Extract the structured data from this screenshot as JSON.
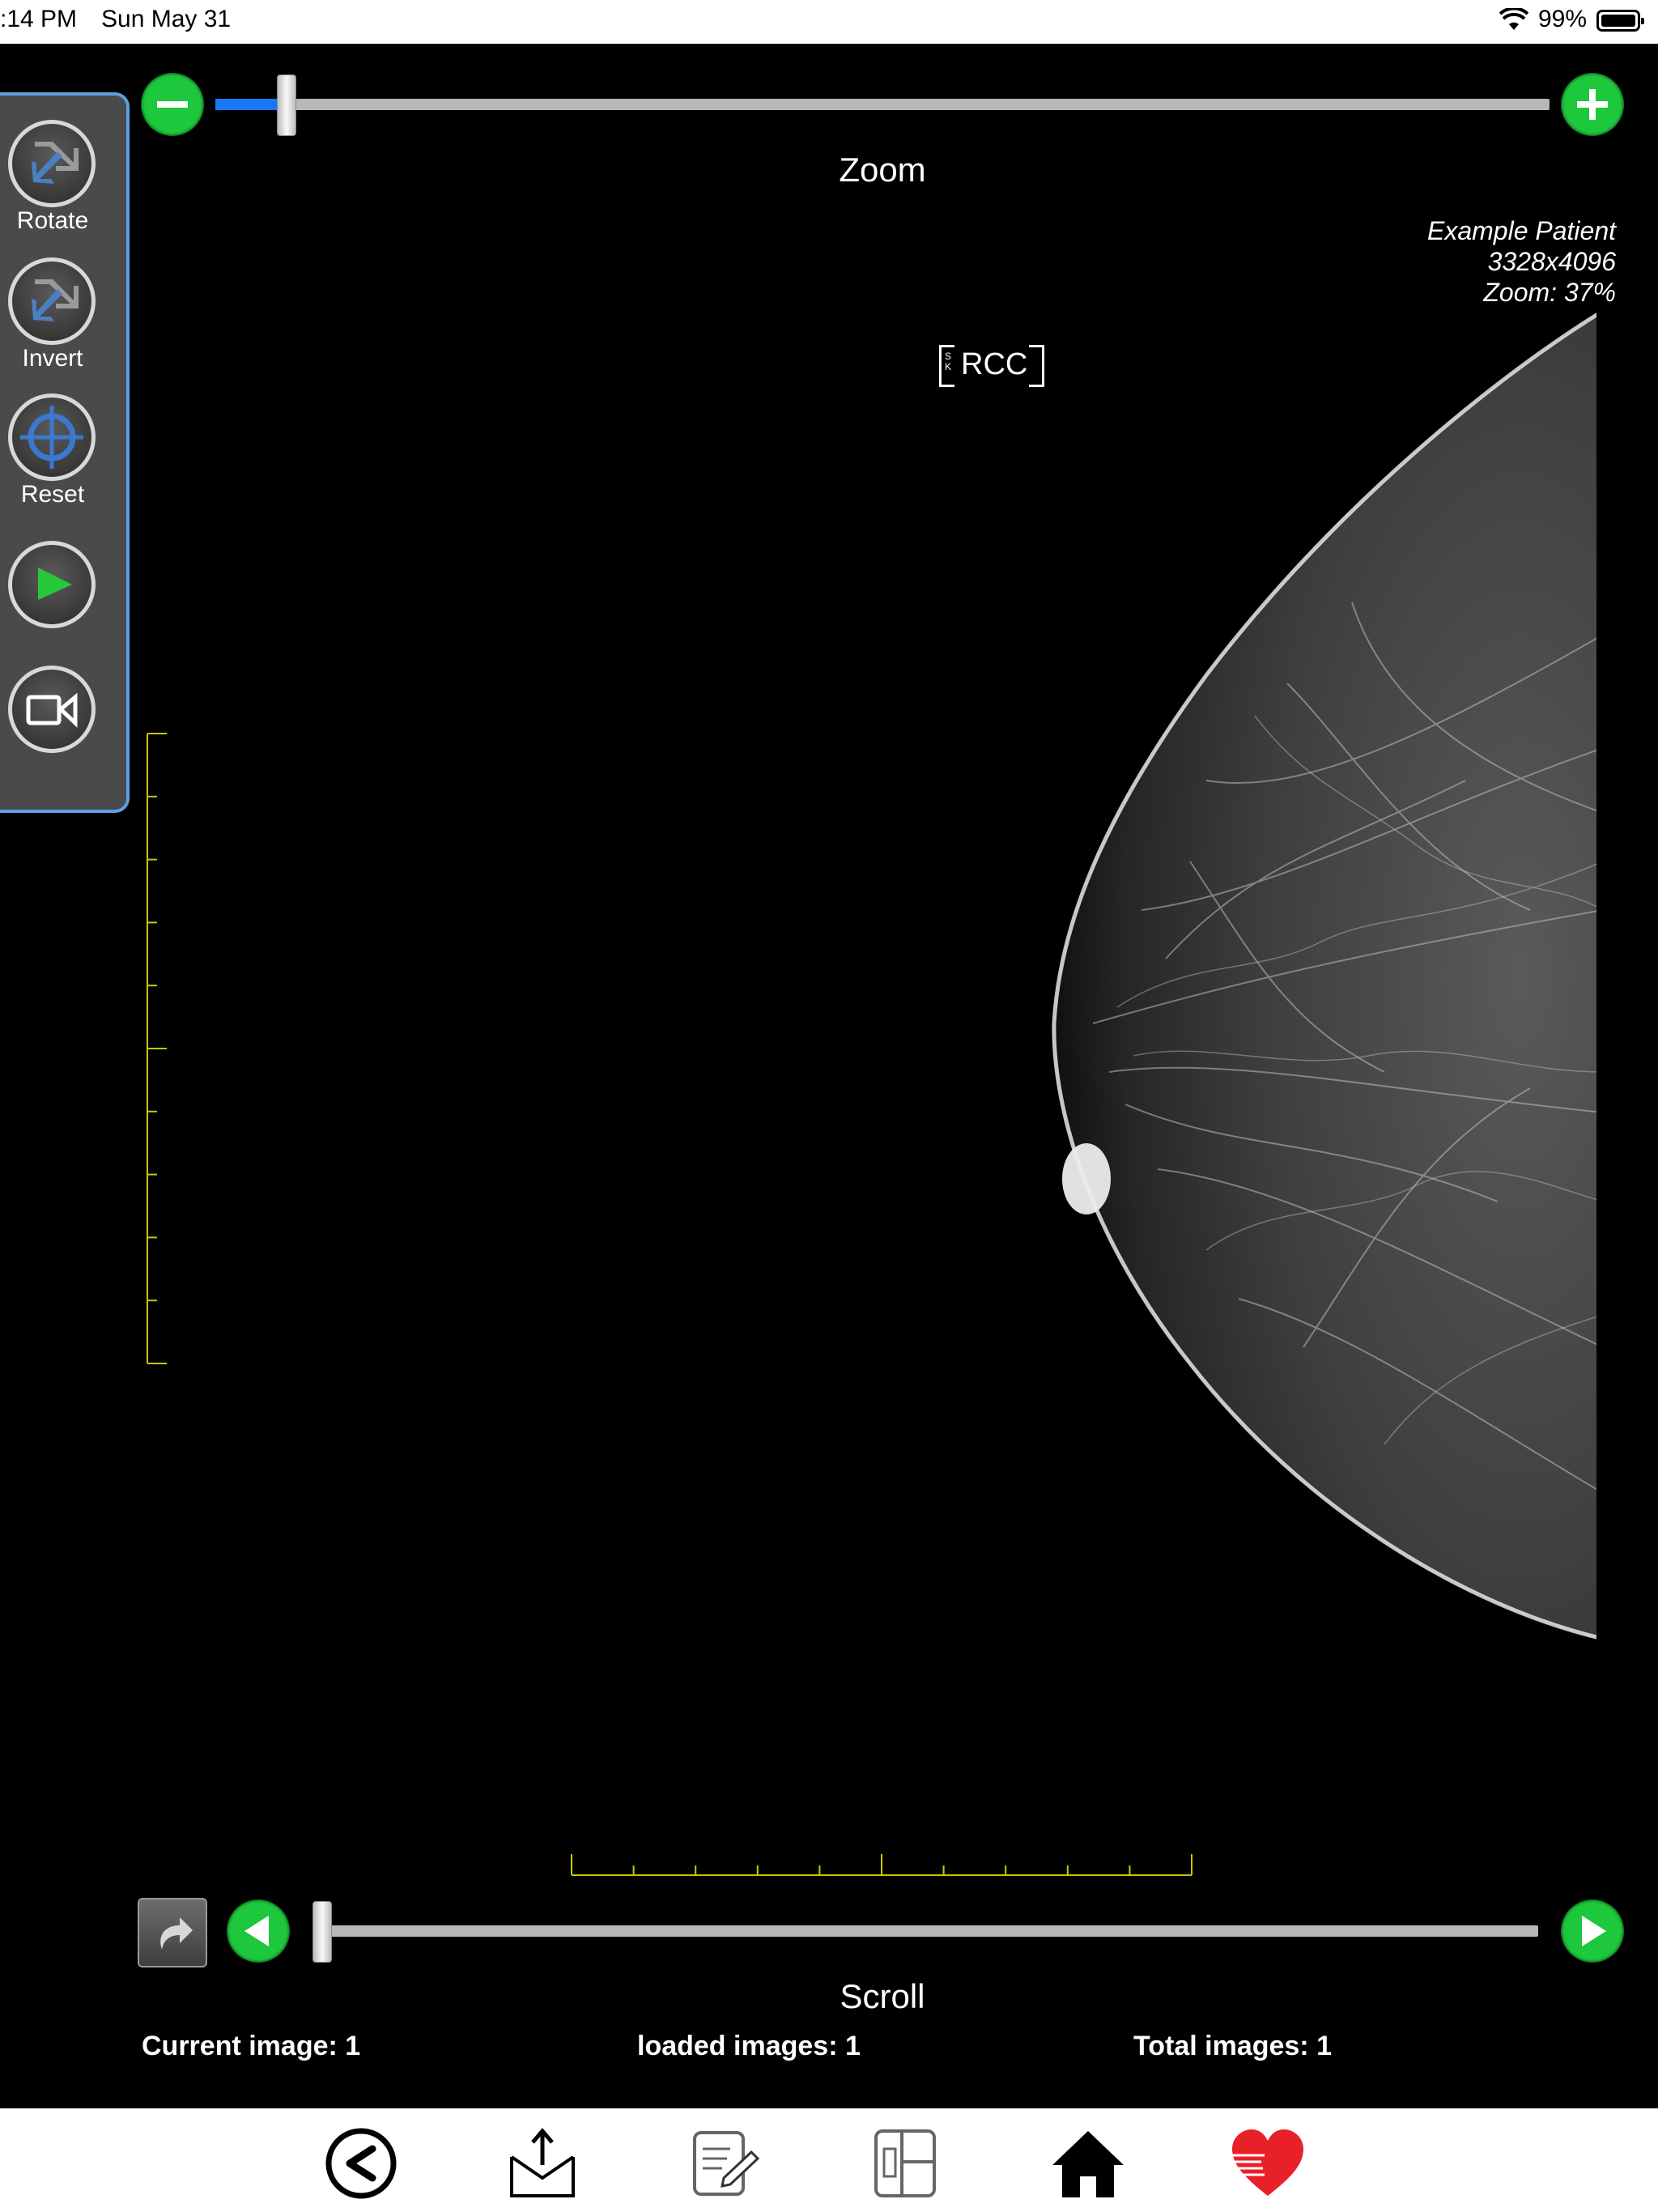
{
  "status_bar": {
    "time": ":14 PM",
    "date": "Sun May 31",
    "battery_percent": "99%",
    "battery_level": 0.99
  },
  "toolbar": {
    "tools": [
      {
        "label": "Rotate",
        "icon": "rotate-icon"
      },
      {
        "label": "Invert",
        "icon": "invert-icon"
      },
      {
        "label": "Reset",
        "icon": "crosshair-icon"
      },
      {
        "label": "",
        "icon": "play-icon"
      },
      {
        "label": "",
        "icon": "video-camera-icon"
      }
    ]
  },
  "zoom": {
    "label": "Zoom",
    "value_fraction": 0.05,
    "minus_icon": "minus-icon",
    "plus_icon": "plus-icon"
  },
  "image_info": {
    "patient": "Example Patient",
    "dimensions": "3328x4096",
    "zoom": "Zoom: 37%"
  },
  "view_label": {
    "text": "RCC",
    "orientation_letters": "S\nK"
  },
  "scroll": {
    "label": "Scroll",
    "value_fraction": 0.0,
    "prev_icon": "triangle-left-icon",
    "next_icon": "triangle-right-icon"
  },
  "stats": {
    "current": "Current image: 1",
    "loaded": "loaded images: 1",
    "total": "Total images: 1"
  },
  "bottom_bar": {
    "icons": [
      "back-icon",
      "share-icon",
      "notes-icon",
      "layout-icon",
      "home-icon",
      "heart-logo-icon"
    ]
  },
  "colors": {
    "green": "#1ec83c",
    "blue_fill": "#1877f2",
    "toolbar_border": "#5aa0e0",
    "ruler": "#c8c800",
    "heart_red": "#e8202a"
  }
}
